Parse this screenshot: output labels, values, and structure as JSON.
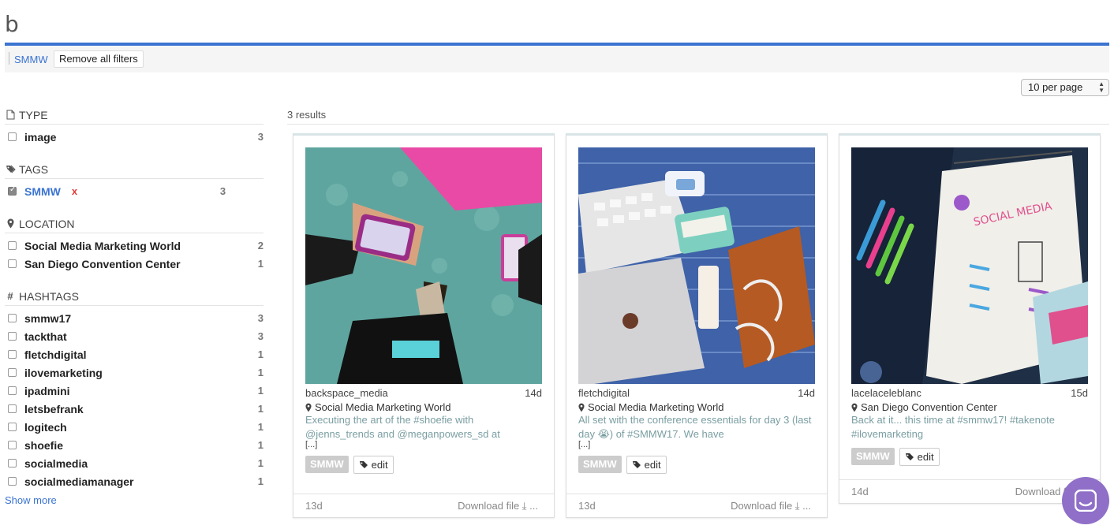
{
  "header": {
    "title": "b"
  },
  "filters": {
    "active_chip": "SMMW",
    "remove_all_label": "Remove all filters"
  },
  "pagination": {
    "per_page": "10 per page"
  },
  "sidebar": {
    "type": {
      "heading": "TYPE",
      "items": [
        {
          "label": "image",
          "count": "3"
        }
      ]
    },
    "tags": {
      "heading": "TAGS",
      "items": [
        {
          "label": "SMMW",
          "count": "3",
          "remove": "x"
        }
      ]
    },
    "location": {
      "heading": "LOCATION",
      "items": [
        {
          "label": "Social Media Marketing World",
          "count": "2"
        },
        {
          "label": "San Diego Convention Center",
          "count": "1"
        }
      ]
    },
    "hashtags": {
      "heading": "HASHTAGS",
      "items": [
        {
          "label": "smmw17",
          "count": "3"
        },
        {
          "label": "tackthat",
          "count": "3"
        },
        {
          "label": "fletchdigital",
          "count": "1"
        },
        {
          "label": "ilovemarketing",
          "count": "1"
        },
        {
          "label": "ipadmini",
          "count": "1"
        },
        {
          "label": "letsbefrank",
          "count": "1"
        },
        {
          "label": "logitech",
          "count": "1"
        },
        {
          "label": "shoefie",
          "count": "1"
        },
        {
          "label": "socialmedia",
          "count": "1"
        },
        {
          "label": "socialmediamanager",
          "count": "1"
        }
      ]
    },
    "show_more": "Show more"
  },
  "results": {
    "count_label": "3 results",
    "cards": [
      {
        "user": "backspace_media",
        "age": "14d",
        "location": "Social Media Marketing World",
        "caption": "Executing the art of the #shoefie with @jenns_trends and @meganpowers_sd at",
        "more": "[...]",
        "tag": "SMMW",
        "edit_label": "edit",
        "footer_age": "13d",
        "download_label": "Download file ⤓ ..."
      },
      {
        "user": "fletchdigital",
        "age": "14d",
        "location": "Social Media Marketing World",
        "caption": "All set with the conference essentials for day 3 (last day 😭) of #SMMW17. We have",
        "more": "[...]",
        "tag": "SMMW",
        "edit_label": "edit",
        "footer_age": "13d",
        "download_label": "Download file ⤓ ..."
      },
      {
        "user": "lacelaceleblanc",
        "age": "15d",
        "location": "San Diego Convention Center",
        "caption": "Back at it... this time at #smmw17! #takenote #ilovemarketing",
        "more": "",
        "tag": "SMMW",
        "edit_label": "edit",
        "footer_age": "14d",
        "download_label": "Download file ⤓"
      }
    ]
  },
  "colors": {
    "accent": "#3b74d1",
    "chat": "#8f6fc7",
    "remove": "#e03b3b"
  }
}
